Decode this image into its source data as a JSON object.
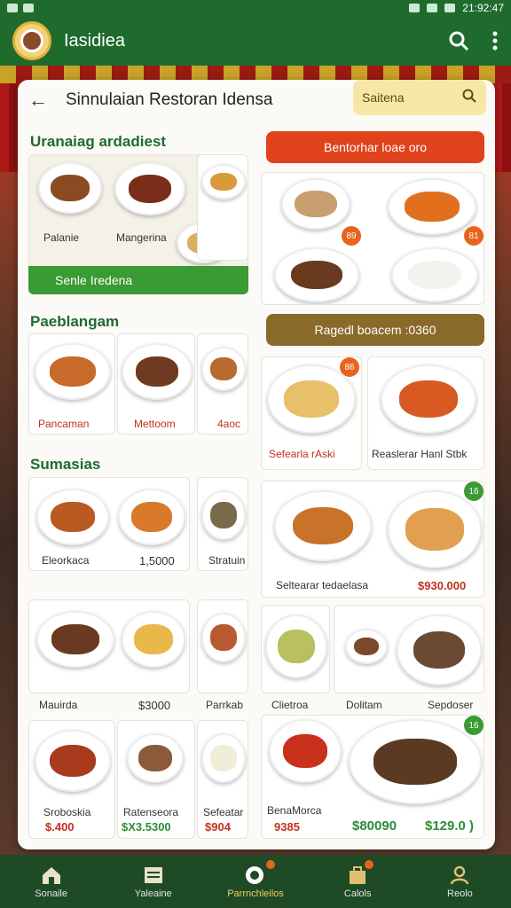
{
  "status_bar": {
    "time": "21:92:47"
  },
  "app_bar": {
    "title": "Iasidiea"
  },
  "panel": {
    "title": "Sinnulaian Restoran Idensa",
    "search": {
      "value": "Saitena"
    }
  },
  "left_sections": [
    {
      "title": "Uranaiag ardadiest",
      "cards": [
        {
          "label": "Palanie"
        },
        {
          "label": "Mangerina"
        }
      ],
      "button": "Senle Iredena"
    },
    {
      "title": "Paeblangam",
      "cards": [
        {
          "label": "Pancaman",
          "price": ""
        },
        {
          "label": "Mettoom",
          "price": ""
        },
        {
          "label": "4aoc",
          "price": ""
        }
      ]
    },
    {
      "title": "Sumasias",
      "cards": [
        {
          "label": "Eleorkaca",
          "price": "1,5000"
        },
        {
          "label": "Stratuin",
          "price": ""
        },
        {
          "label": "Mauirda",
          "price": "$3000"
        },
        {
          "label": "Parrkab",
          "price": ""
        },
        {
          "label": "Sroboskia",
          "price": "$.400"
        },
        {
          "label": "Ratenseora",
          "price": "$X3.5300"
        },
        {
          "label": "Sefeatar",
          "price": "$904"
        }
      ]
    }
  ],
  "right_column": {
    "top_button": "Bentorhar loae oro",
    "badges": [
      "89",
      "81",
      "86",
      "16",
      "16"
    ],
    "mid_button": "Ragedl boacem :0360",
    "cards": [
      {
        "label": "Sefearla rAski"
      },
      {
        "label": "Reaslerar Hanl Stbk"
      },
      {
        "label": "Seltearar tedaelasa",
        "price": "$930.000"
      },
      {
        "label": "Clietroa"
      },
      {
        "label": "Dolitam"
      },
      {
        "label": "Sepdoser"
      },
      {
        "label": "BenaMorca",
        "price": "9385"
      },
      {
        "label": "",
        "price": "$80090"
      },
      {
        "label": "",
        "price": "$129.0 )"
      }
    ]
  },
  "bottom_nav": [
    {
      "label": "Sonaile",
      "icon": "home-icon"
    },
    {
      "label": "Yaleaine",
      "icon": "menu-board-icon"
    },
    {
      "label": "Parrnchleilos",
      "icon": "order-icon"
    },
    {
      "label": "Calols",
      "icon": "bag-icon"
    },
    {
      "label": "Reolo",
      "icon": "profile-icon"
    }
  ],
  "colors": {
    "primary": "#1f6b2e",
    "accent_red": "#e0421c",
    "accent_green": "#3a9a33",
    "price_red": "#c0321c",
    "price_green": "#2e8b36"
  }
}
